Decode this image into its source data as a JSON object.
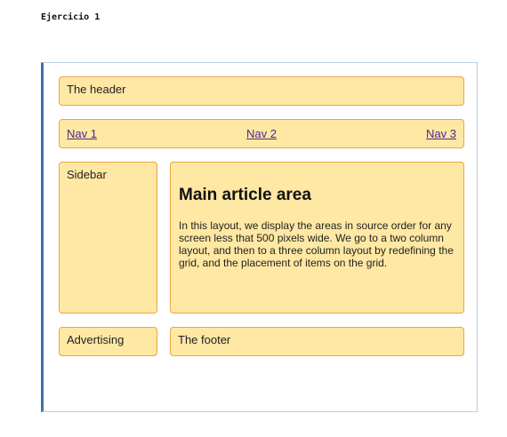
{
  "page": {
    "exercise_title": "Ejercicio 1"
  },
  "layout_demo": {
    "header": "The header",
    "nav": [
      {
        "label": "Nav 1"
      },
      {
        "label": "Nav 2"
      },
      {
        "label": "Nav 3"
      }
    ],
    "sidebar": "Sidebar",
    "main": {
      "heading": "Main article area",
      "text": "In this layout, we display the areas in source order for any screen less that 500 pixels wide. We go to a two column layout, and then to a three column layout by redefining the grid, and the placement of items on the grid."
    },
    "advertising": "Advertising",
    "footer": "The footer"
  },
  "colors": {
    "box_fill": "#ffe8a3",
    "box_border": "#f0a340",
    "frame_accent": "#3f73a8",
    "link": "#4a2a8c"
  }
}
